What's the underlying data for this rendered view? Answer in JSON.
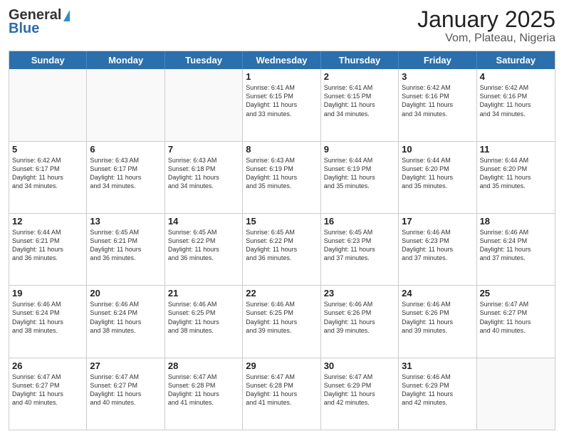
{
  "logo": {
    "line1": "General",
    "line2": "Blue"
  },
  "title": "January 2025",
  "subtitle": "Vom, Plateau, Nigeria",
  "days": [
    "Sunday",
    "Monday",
    "Tuesday",
    "Wednesday",
    "Thursday",
    "Friday",
    "Saturday"
  ],
  "weeks": [
    [
      {
        "day": "",
        "info": ""
      },
      {
        "day": "",
        "info": ""
      },
      {
        "day": "",
        "info": ""
      },
      {
        "day": "1",
        "info": "Sunrise: 6:41 AM\nSunset: 6:15 PM\nDaylight: 11 hours\nand 33 minutes."
      },
      {
        "day": "2",
        "info": "Sunrise: 6:41 AM\nSunset: 6:15 PM\nDaylight: 11 hours\nand 34 minutes."
      },
      {
        "day": "3",
        "info": "Sunrise: 6:42 AM\nSunset: 6:16 PM\nDaylight: 11 hours\nand 34 minutes."
      },
      {
        "day": "4",
        "info": "Sunrise: 6:42 AM\nSunset: 6:16 PM\nDaylight: 11 hours\nand 34 minutes."
      }
    ],
    [
      {
        "day": "5",
        "info": "Sunrise: 6:42 AM\nSunset: 6:17 PM\nDaylight: 11 hours\nand 34 minutes."
      },
      {
        "day": "6",
        "info": "Sunrise: 6:43 AM\nSunset: 6:17 PM\nDaylight: 11 hours\nand 34 minutes."
      },
      {
        "day": "7",
        "info": "Sunrise: 6:43 AM\nSunset: 6:18 PM\nDaylight: 11 hours\nand 34 minutes."
      },
      {
        "day": "8",
        "info": "Sunrise: 6:43 AM\nSunset: 6:19 PM\nDaylight: 11 hours\nand 35 minutes."
      },
      {
        "day": "9",
        "info": "Sunrise: 6:44 AM\nSunset: 6:19 PM\nDaylight: 11 hours\nand 35 minutes."
      },
      {
        "day": "10",
        "info": "Sunrise: 6:44 AM\nSunset: 6:20 PM\nDaylight: 11 hours\nand 35 minutes."
      },
      {
        "day": "11",
        "info": "Sunrise: 6:44 AM\nSunset: 6:20 PM\nDaylight: 11 hours\nand 35 minutes."
      }
    ],
    [
      {
        "day": "12",
        "info": "Sunrise: 6:44 AM\nSunset: 6:21 PM\nDaylight: 11 hours\nand 36 minutes."
      },
      {
        "day": "13",
        "info": "Sunrise: 6:45 AM\nSunset: 6:21 PM\nDaylight: 11 hours\nand 36 minutes."
      },
      {
        "day": "14",
        "info": "Sunrise: 6:45 AM\nSunset: 6:22 PM\nDaylight: 11 hours\nand 36 minutes."
      },
      {
        "day": "15",
        "info": "Sunrise: 6:45 AM\nSunset: 6:22 PM\nDaylight: 11 hours\nand 36 minutes."
      },
      {
        "day": "16",
        "info": "Sunrise: 6:45 AM\nSunset: 6:23 PM\nDaylight: 11 hours\nand 37 minutes."
      },
      {
        "day": "17",
        "info": "Sunrise: 6:46 AM\nSunset: 6:23 PM\nDaylight: 11 hours\nand 37 minutes."
      },
      {
        "day": "18",
        "info": "Sunrise: 6:46 AM\nSunset: 6:24 PM\nDaylight: 11 hours\nand 37 minutes."
      }
    ],
    [
      {
        "day": "19",
        "info": "Sunrise: 6:46 AM\nSunset: 6:24 PM\nDaylight: 11 hours\nand 38 minutes."
      },
      {
        "day": "20",
        "info": "Sunrise: 6:46 AM\nSunset: 6:24 PM\nDaylight: 11 hours\nand 38 minutes."
      },
      {
        "day": "21",
        "info": "Sunrise: 6:46 AM\nSunset: 6:25 PM\nDaylight: 11 hours\nand 38 minutes."
      },
      {
        "day": "22",
        "info": "Sunrise: 6:46 AM\nSunset: 6:25 PM\nDaylight: 11 hours\nand 39 minutes."
      },
      {
        "day": "23",
        "info": "Sunrise: 6:46 AM\nSunset: 6:26 PM\nDaylight: 11 hours\nand 39 minutes."
      },
      {
        "day": "24",
        "info": "Sunrise: 6:46 AM\nSunset: 6:26 PM\nDaylight: 11 hours\nand 39 minutes."
      },
      {
        "day": "25",
        "info": "Sunrise: 6:47 AM\nSunset: 6:27 PM\nDaylight: 11 hours\nand 40 minutes."
      }
    ],
    [
      {
        "day": "26",
        "info": "Sunrise: 6:47 AM\nSunset: 6:27 PM\nDaylight: 11 hours\nand 40 minutes."
      },
      {
        "day": "27",
        "info": "Sunrise: 6:47 AM\nSunset: 6:27 PM\nDaylight: 11 hours\nand 40 minutes."
      },
      {
        "day": "28",
        "info": "Sunrise: 6:47 AM\nSunset: 6:28 PM\nDaylight: 11 hours\nand 41 minutes."
      },
      {
        "day": "29",
        "info": "Sunrise: 6:47 AM\nSunset: 6:28 PM\nDaylight: 11 hours\nand 41 minutes."
      },
      {
        "day": "30",
        "info": "Sunrise: 6:47 AM\nSunset: 6:29 PM\nDaylight: 11 hours\nand 42 minutes."
      },
      {
        "day": "31",
        "info": "Sunrise: 6:46 AM\nSunset: 6:29 PM\nDaylight: 11 hours\nand 42 minutes."
      },
      {
        "day": "",
        "info": ""
      }
    ]
  ]
}
